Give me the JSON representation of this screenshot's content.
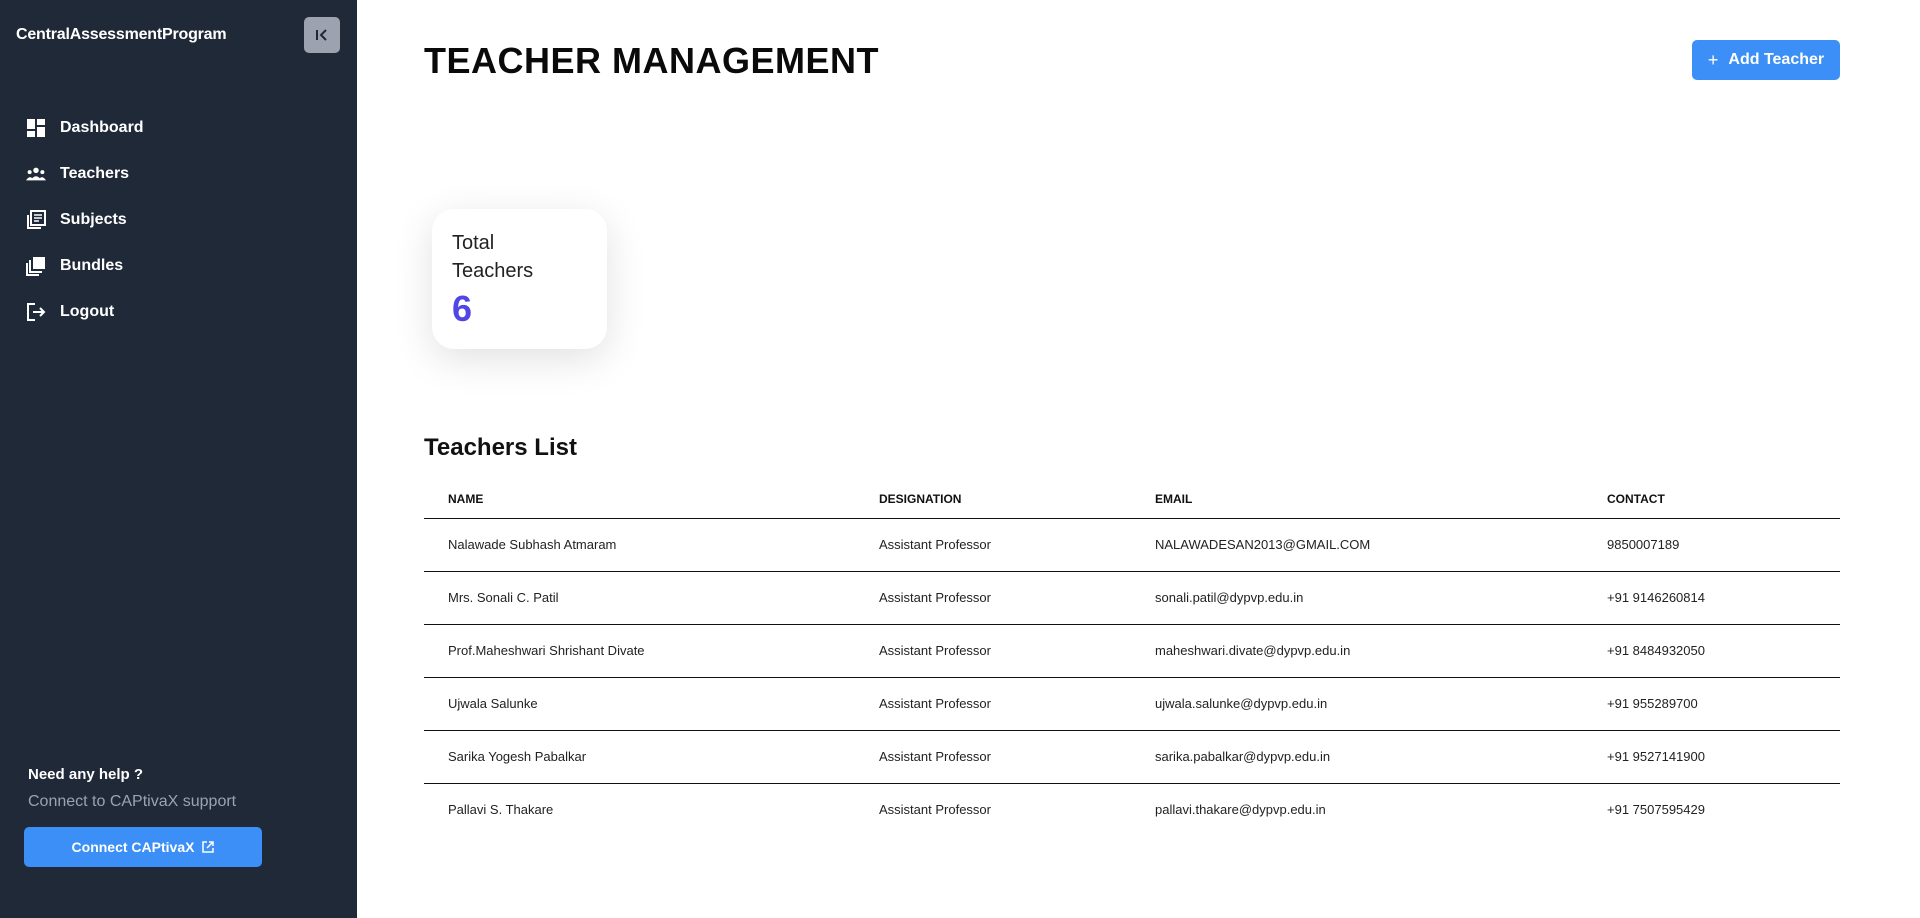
{
  "sidebar": {
    "brand": "CentralAssessmentProgram",
    "nav": [
      {
        "label": "Dashboard",
        "icon": "dashboard-icon"
      },
      {
        "label": "Teachers",
        "icon": "people-icon"
      },
      {
        "label": "Subjects",
        "icon": "library-icon"
      },
      {
        "label": "Bundles",
        "icon": "layers-icon"
      },
      {
        "label": "Logout",
        "icon": "logout-icon"
      }
    ],
    "help_title": "Need any help ?",
    "help_subtitle": "Connect to CAPtivaX support",
    "connect_label": "Connect CAPtivaX"
  },
  "main": {
    "title": "TEACHER MANAGEMENT",
    "add_button": "Add Teacher",
    "stat": {
      "label": "Total Teachers",
      "value": "6"
    },
    "list_title": "Teachers List",
    "columns": [
      "NAME",
      "DESIGNATION",
      "EMAIL",
      "CONTACT"
    ],
    "rows": [
      {
        "name": "Nalawade Subhash Atmaram",
        "designation": "Assistant Professor",
        "email": "NALAWADESAN2013@GMAIL.COM",
        "contact": "9850007189"
      },
      {
        "name": "Mrs. Sonali C. Patil",
        "designation": "Assistant Professor",
        "email": "sonali.patil@dypvp.edu.in",
        "contact": "+91 9146260814"
      },
      {
        "name": "Prof.Maheshwari Shrishant Divate",
        "designation": "Assistant Professor",
        "email": "maheshwari.divate@dypvp.edu.in",
        "contact": "+91 8484932050"
      },
      {
        "name": "Ujwala Salunke",
        "designation": "Assistant Professor",
        "email": "ujwala.salunke@dypvp.edu.in",
        "contact": "+91 955289700"
      },
      {
        "name": "Sarika Yogesh Pabalkar",
        "designation": "Assistant Professor",
        "email": "sarika.pabalkar@dypvp.edu.in",
        "contact": "+91 9527141900"
      },
      {
        "name": "Pallavi S. Thakare",
        "designation": "Assistant Professor",
        "email": "pallavi.thakare@dypvp.edu.in",
        "contact": "+91 7507595429"
      }
    ]
  },
  "colors": {
    "sidebar_bg": "#1f2937",
    "accent": "#3b8ff6",
    "stat_value": "#4f46e5"
  }
}
